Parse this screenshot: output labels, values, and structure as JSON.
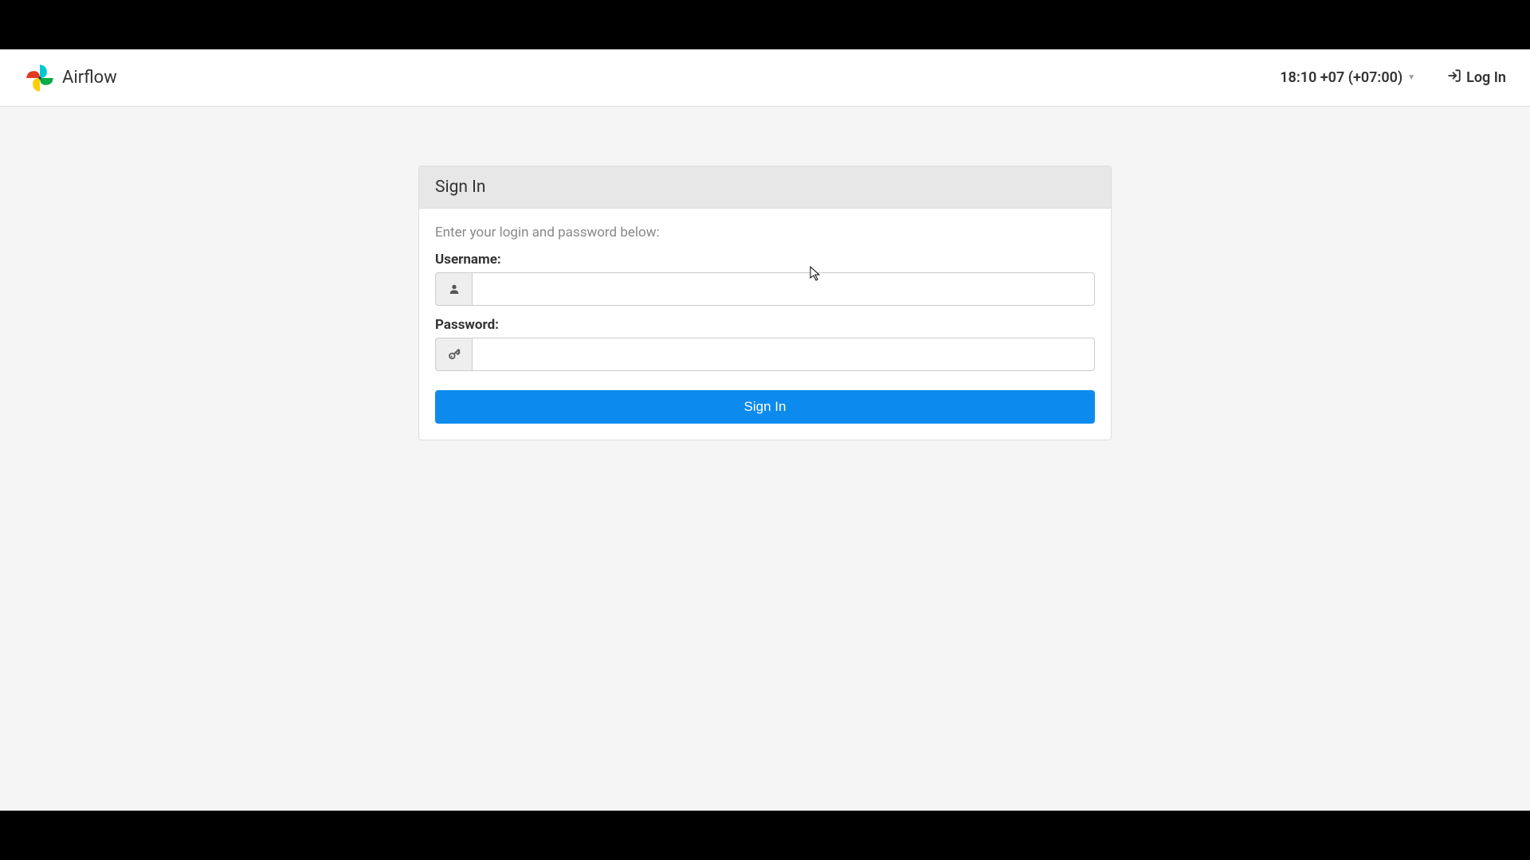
{
  "brand": {
    "name": "Airflow"
  },
  "navbar": {
    "time_tz": "18:10 +07 (+07:00)",
    "login_label": "Log In"
  },
  "panel": {
    "title": "Sign In",
    "intro": "Enter your login and password below:",
    "username_label": "Username:",
    "password_label": "Password:",
    "username_value": "",
    "password_value": "",
    "submit_label": "Sign In"
  },
  "colors": {
    "primary": "#0d8aee",
    "panel_header": "#e7e7e7",
    "border": "#ddd"
  }
}
